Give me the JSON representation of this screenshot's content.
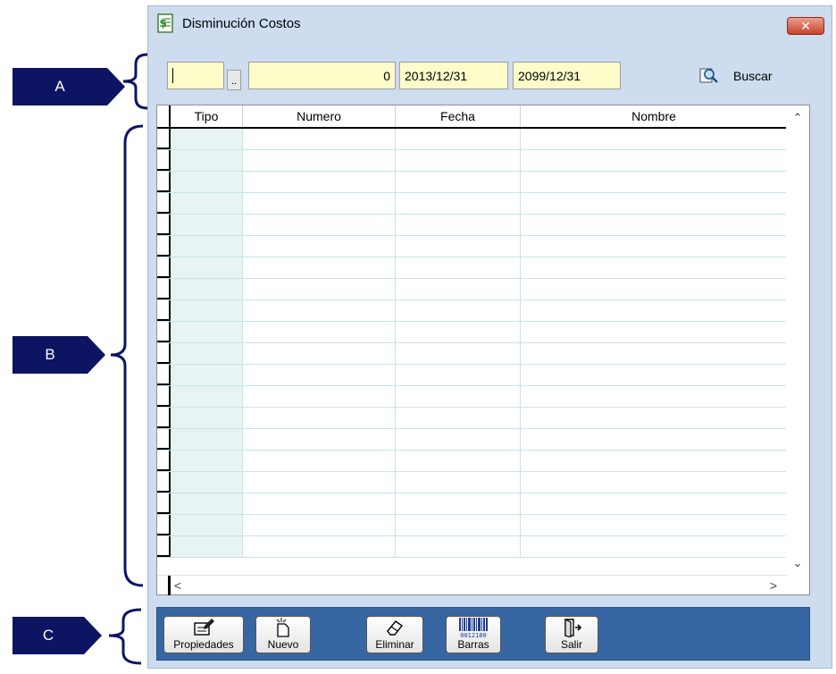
{
  "callouts": {
    "a": "A",
    "b": "B",
    "c": "C"
  },
  "window": {
    "title": "Disminución Costos",
    "close_symbol": "✕"
  },
  "filter": {
    "code_value": "",
    "browse_label": "..",
    "number_value": "0",
    "date_from": "2013/12/31",
    "date_to": "2099/12/31",
    "search_label": "Buscar"
  },
  "grid": {
    "columns": [
      "Tipo",
      "Numero",
      "Fecha",
      "Nombre"
    ],
    "rows": 20
  },
  "scroll": {
    "up": "⌃",
    "down": "⌄",
    "left": "<",
    "right": ">"
  },
  "toolbar": {
    "properties_label": "Propiedades",
    "new_label": "Nuevo",
    "delete_label": "Eliminar",
    "barcode_label": "Barras",
    "exit_label": "Salir"
  },
  "colors": {
    "callout": "#0d1462",
    "window_bg": "#cddcef",
    "field_bg": "#fdfdca",
    "toolbar_bg": "#3767a2"
  }
}
